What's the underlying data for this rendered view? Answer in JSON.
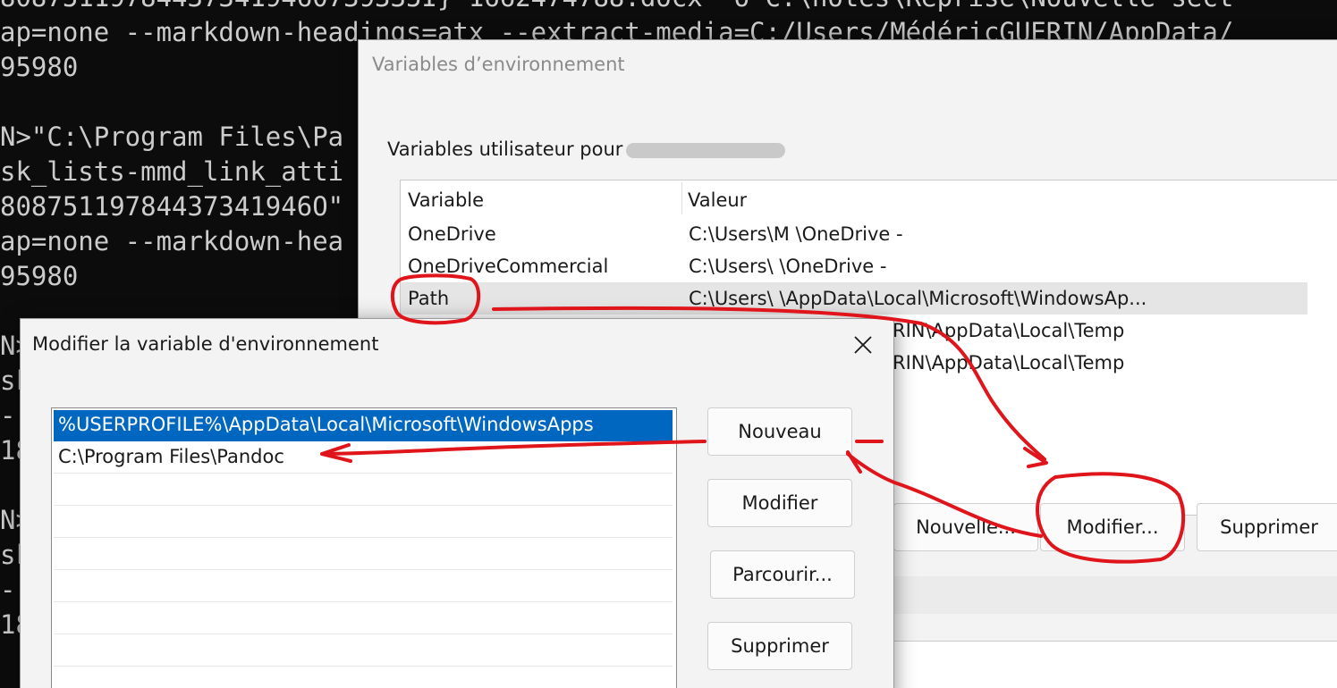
{
  "terminal": {
    "lines": [
      "808751197844373419460739335I}-1662474788.docx -o C:\\notes\\Reprise\\Nouvelle-sect",
      "ap=none --markdown-headings=atx --extract-media=C:/Users/MédéricGUERIN/AppData/",
      "95980",
      "",
      "N>\"C:\\Program Files\\Pa",
      "sk_lists-mmd_link_atti",
      "80875119784437341946O\"",
      "ap=none --markdown-hea",
      "95980",
      "",
      "N>",
      "sk",
      "--",
      "18",
      "",
      "N>",
      "sk",
      "--",
      "18"
    ]
  },
  "env_window": {
    "title": "Variables d’environnement",
    "user_group_label": "Variables utilisateur pour",
    "columns": {
      "variable": "Variable",
      "value": "Valeur"
    },
    "rows": [
      {
        "variable": "OneDrive",
        "value": "C:\\Users\\M          \\OneDrive - "
      },
      {
        "variable": "OneDriveCommercial",
        "value": "C:\\Users\\            \\OneDrive - "
      },
      {
        "variable": "Path",
        "value": "C:\\Users\\             \\AppData\\Local\\Microsoft\\WindowsAp..."
      },
      {
        "variable": "",
        "value": "RIN\\AppData\\Local\\Temp"
      },
      {
        "variable": "",
        "value": "RIN\\AppData\\Local\\Temp"
      }
    ],
    "buttons": {
      "new": "Nouvelle...",
      "edit": "Modifier...",
      "delete": "Supprimer"
    }
  },
  "edit_dialog": {
    "title": "Modifier la variable d'environnement",
    "entries": [
      "%USERPROFILE%\\AppData\\Local\\Microsoft\\WindowsApps",
      "C:\\Program Files\\Pandoc",
      "",
      "",
      "",
      "",
      "",
      "",
      ""
    ],
    "buttons": {
      "new": "Nouveau",
      "edit": "Modifier",
      "browse": "Parcourir...",
      "delete": "Supprimer"
    }
  },
  "colors": {
    "annotation": "#e0141b",
    "selection": "#0067c0",
    "terminal_bg": "#0c0c0c",
    "terminal_fg": "#cccccc"
  },
  "icons": {
    "close": "close-icon"
  }
}
